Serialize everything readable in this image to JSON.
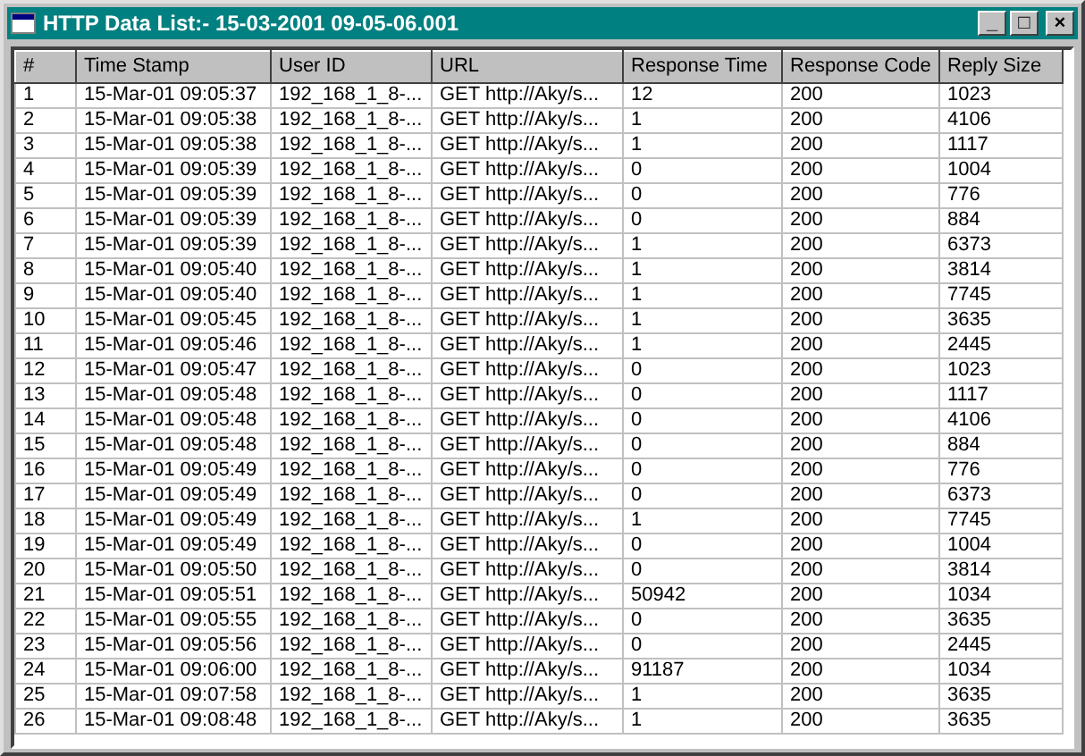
{
  "window": {
    "title": "HTTP Data List:- 15-03-2001 09-05-06.001",
    "controls": [
      "_",
      "□",
      "×"
    ]
  },
  "table": {
    "columns": [
      "#",
      "Time Stamp",
      "User ID",
      "URL",
      "Response Time",
      "Response Code",
      "Reply Size"
    ],
    "rows": [
      [
        "1",
        "15-Mar-01 09:05:37",
        "192_168_1_8-...",
        "GET http://Aky/s...",
        "12",
        "200",
        "1023"
      ],
      [
        "2",
        "15-Mar-01 09:05:38",
        "192_168_1_8-...",
        "GET http://Aky/s...",
        "1",
        "200",
        "4106"
      ],
      [
        "3",
        "15-Mar-01 09:05:38",
        "192_168_1_8-...",
        "GET http://Aky/s...",
        "1",
        "200",
        "1117"
      ],
      [
        "4",
        "15-Mar-01 09:05:39",
        "192_168_1_8-...",
        "GET http://Aky/s...",
        "0",
        "200",
        "1004"
      ],
      [
        "5",
        "15-Mar-01 09:05:39",
        "192_168_1_8-...",
        "GET http://Aky/s...",
        "0",
        "200",
        "776"
      ],
      [
        "6",
        "15-Mar-01 09:05:39",
        "192_168_1_8-...",
        "GET http://Aky/s...",
        "0",
        "200",
        "884"
      ],
      [
        "7",
        "15-Mar-01 09:05:39",
        "192_168_1_8-...",
        "GET http://Aky/s...",
        "1",
        "200",
        "6373"
      ],
      [
        "8",
        "15-Mar-01 09:05:40",
        "192_168_1_8-...",
        "GET http://Aky/s...",
        "1",
        "200",
        "3814"
      ],
      [
        "9",
        "15-Mar-01 09:05:40",
        "192_168_1_8-...",
        "GET http://Aky/s...",
        "1",
        "200",
        "7745"
      ],
      [
        "10",
        "15-Mar-01 09:05:45",
        "192_168_1_8-...",
        "GET http://Aky/s...",
        "1",
        "200",
        "3635"
      ],
      [
        "11",
        "15-Mar-01 09:05:46",
        "192_168_1_8-...",
        "GET http://Aky/s...",
        "1",
        "200",
        "2445"
      ],
      [
        "12",
        "15-Mar-01 09:05:47",
        "192_168_1_8-...",
        "GET http://Aky/s...",
        "0",
        "200",
        "1023"
      ],
      [
        "13",
        "15-Mar-01 09:05:48",
        "192_168_1_8-...",
        "GET http://Aky/s...",
        "0",
        "200",
        "1117"
      ],
      [
        "14",
        "15-Mar-01 09:05:48",
        "192_168_1_8-...",
        "GET http://Aky/s...",
        "0",
        "200",
        "4106"
      ],
      [
        "15",
        "15-Mar-01 09:05:48",
        "192_168_1_8-...",
        "GET http://Aky/s...",
        "0",
        "200",
        "884"
      ],
      [
        "16",
        "15-Mar-01 09:05:49",
        "192_168_1_8-...",
        "GET http://Aky/s...",
        "0",
        "200",
        "776"
      ],
      [
        "17",
        "15-Mar-01 09:05:49",
        "192_168_1_8-...",
        "GET http://Aky/s...",
        "0",
        "200",
        "6373"
      ],
      [
        "18",
        "15-Mar-01 09:05:49",
        "192_168_1_8-...",
        "GET http://Aky/s...",
        "1",
        "200",
        "7745"
      ],
      [
        "19",
        "15-Mar-01 09:05:49",
        "192_168_1_8-...",
        "GET http://Aky/s...",
        "0",
        "200",
        "1004"
      ],
      [
        "20",
        "15-Mar-01 09:05:50",
        "192_168_1_8-...",
        "GET http://Aky/s...",
        "0",
        "200",
        "3814"
      ],
      [
        "21",
        "15-Mar-01 09:05:51",
        "192_168_1_8-...",
        "GET http://Aky/s...",
        "50942",
        "200",
        "1034"
      ],
      [
        "22",
        "15-Mar-01 09:05:55",
        "192_168_1_8-...",
        "GET http://Aky/s...",
        "0",
        "200",
        "3635"
      ],
      [
        "23",
        "15-Mar-01 09:05:56",
        "192_168_1_8-...",
        "GET http://Aky/s...",
        "0",
        "200",
        "2445"
      ],
      [
        "24",
        "15-Mar-01 09:06:00",
        "192_168_1_8-...",
        "GET http://Aky/s...",
        "91187",
        "200",
        "1034"
      ],
      [
        "25",
        "15-Mar-01 09:07:58",
        "192_168_1_8-...",
        "GET http://Aky/s...",
        "1",
        "200",
        "3635"
      ],
      [
        "26",
        "15-Mar-01 09:08:48",
        "192_168_1_8-...",
        "GET http://Aky/s...",
        "1",
        "200",
        "3635"
      ]
    ]
  }
}
